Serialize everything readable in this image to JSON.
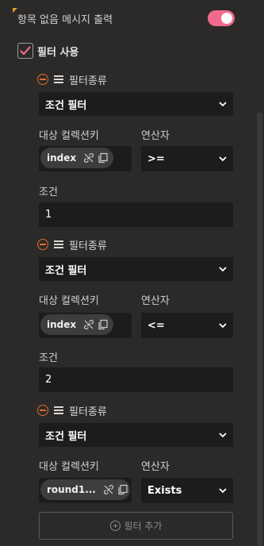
{
  "settings": {
    "empty_message_label": "항목 없음 메시지 출력",
    "empty_message_enabled": true,
    "use_filter_label": "필터 사용",
    "use_filter_checked": true
  },
  "filters": [
    {
      "type_label": "필터종류",
      "type_value": "조건 필터",
      "key_label": "대상 컬렉션키",
      "key_value": "index",
      "op_label": "연산자",
      "op_value": ">=",
      "cond_label": "조건",
      "cond_value": "1"
    },
    {
      "type_label": "필터종류",
      "type_value": "조건 필터",
      "key_label": "대상 컬렉션키",
      "key_value": "index",
      "op_label": "연산자",
      "op_value": "<=",
      "cond_label": "조건",
      "cond_value": "2"
    },
    {
      "type_label": "필터종류",
      "type_value": "조건 필터",
      "key_label": "대상 컬렉션키",
      "key_value": "round1...",
      "op_label": "연산자",
      "op_value": "Exists"
    }
  ],
  "add_filter_label": "필터 추가",
  "colors": {
    "accent": "#f06a8c",
    "remove": "#e06b2c",
    "field_bg": "#1b1c1e"
  }
}
